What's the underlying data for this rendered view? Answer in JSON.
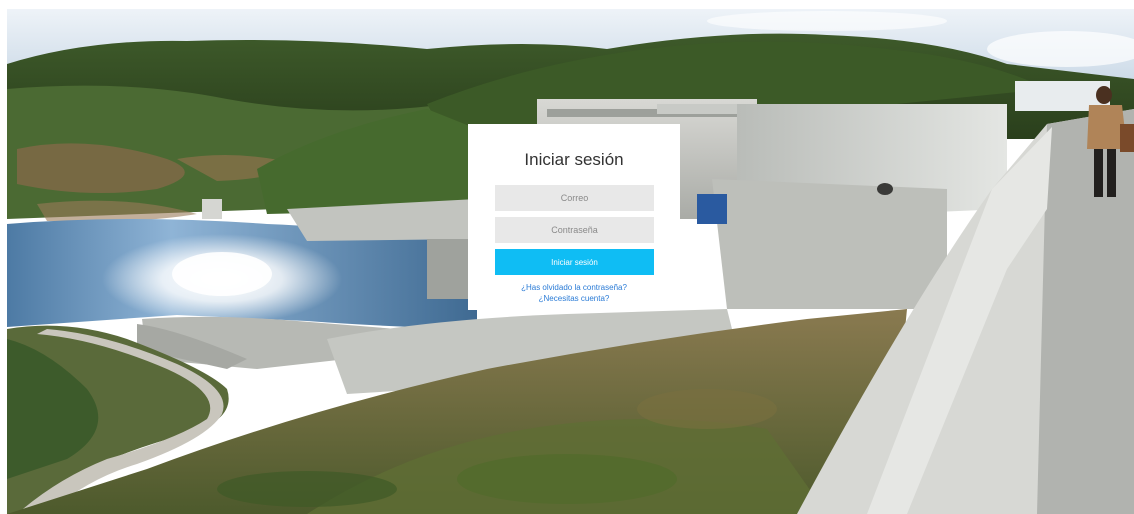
{
  "login": {
    "title": "Iniciar sesión",
    "email_placeholder": "Correo",
    "password_placeholder": "Contraseña",
    "submit_label": "Iniciar sesión",
    "forgot_password_link": "¿Has olvidado la contraseña?",
    "signup_link": "¿Necesitas cuenta?"
  },
  "colors": {
    "button": "#0fbdf4",
    "link": "#2a7bd6",
    "field_background": "#e8e8e8",
    "card_background": "#ffffff"
  }
}
